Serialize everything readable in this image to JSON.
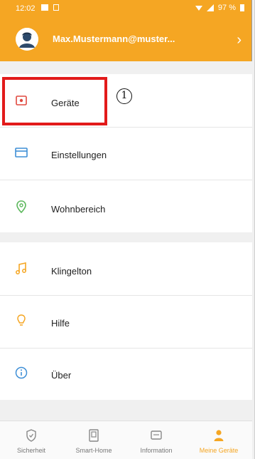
{
  "statusbar": {
    "time": "12:02",
    "battery": "97 %"
  },
  "header": {
    "account": "Max.Mustermann@muster...",
    "chevron": "›"
  },
  "menu_group1": [
    {
      "label": "Geräte",
      "icon": "device-icon"
    },
    {
      "label": "Einstellungen",
      "icon": "settings-window-icon"
    },
    {
      "label": "Wohnbereich",
      "icon": "location-pin-icon"
    }
  ],
  "menu_group2": [
    {
      "label": "Klingelton",
      "icon": "music-note-icon"
    },
    {
      "label": "Hilfe",
      "icon": "lightbulb-icon"
    },
    {
      "label": "Über",
      "icon": "info-icon"
    }
  ],
  "annotation": {
    "number": "1"
  },
  "bottom_nav": [
    {
      "label": "Sicherheit",
      "icon": "shield-icon"
    },
    {
      "label": "Smart-Home",
      "icon": "smart-home-icon"
    },
    {
      "label": "Information",
      "icon": "message-icon"
    },
    {
      "label": "Meine Geräte",
      "icon": "person-icon",
      "active": true
    }
  ],
  "colors": {
    "accent": "#f5a623",
    "highlight": "#e21a1a",
    "icon_blue": "#3f8fd6",
    "icon_green": "#5cb85c",
    "icon_red": "#e0483e"
  }
}
